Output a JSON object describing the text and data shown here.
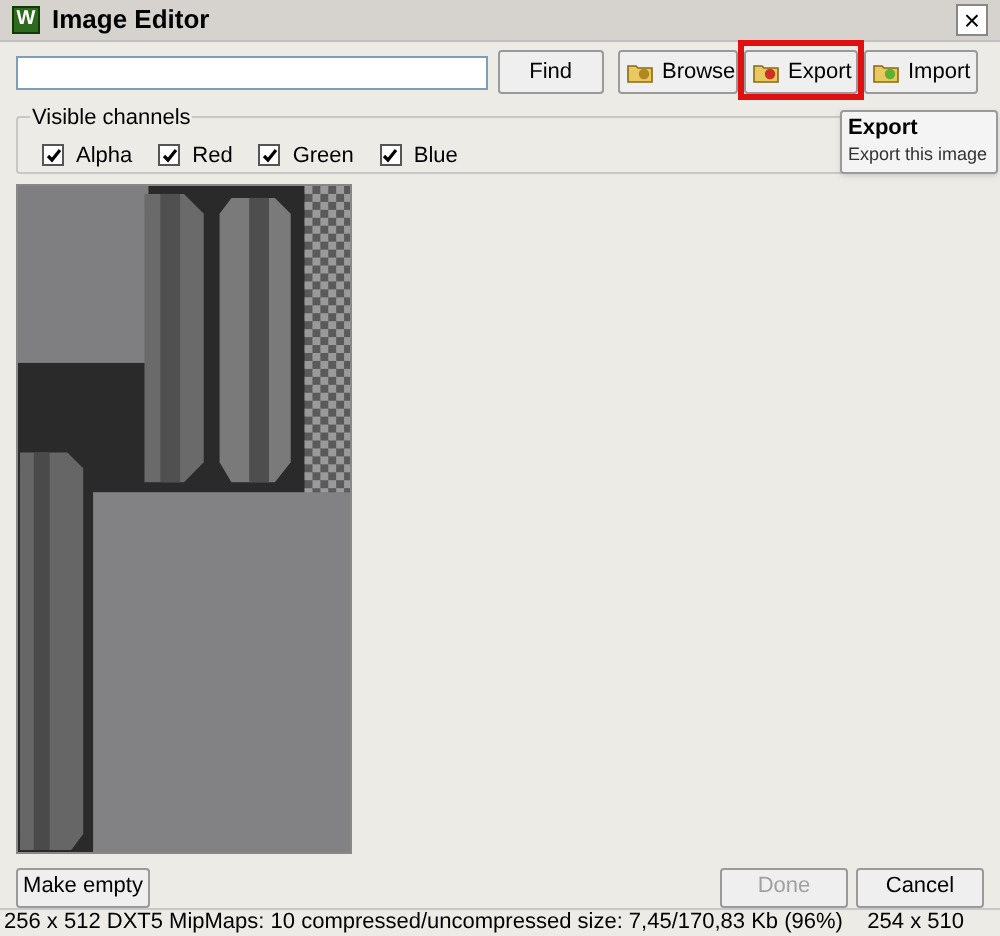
{
  "window": {
    "title": "Image Editor",
    "app_badge": "W",
    "close": "×"
  },
  "search": {
    "button": "Find"
  },
  "toolbar": [
    {
      "label": "Browse",
      "highlighted": false
    },
    {
      "label": "Export",
      "highlighted": true
    },
    {
      "label": "Import",
      "highlighted": false
    }
  ],
  "tooltip": {
    "title": "Export",
    "text": "Export this image"
  },
  "channels": {
    "title": "Visible channels",
    "items": [
      {
        "label": "Alpha",
        "checked": true
      },
      {
        "label": "Red",
        "checked": true
      },
      {
        "label": "Green",
        "checked": true
      },
      {
        "label": "Blue",
        "checked": true
      }
    ]
  },
  "buttons": [
    {
      "label": "Make empty",
      "disabled": false
    },
    {
      "label": "Done",
      "disabled": true
    },
    {
      "label": "Cancel",
      "disabled": false
    }
  ],
  "status_bar": {
    "info": "256 x 512 DXT5 MipMaps: 10 compressed/uncompressed size: 7,45/170,83 Kb (96%)",
    "dimensions": "254 x 510"
  }
}
